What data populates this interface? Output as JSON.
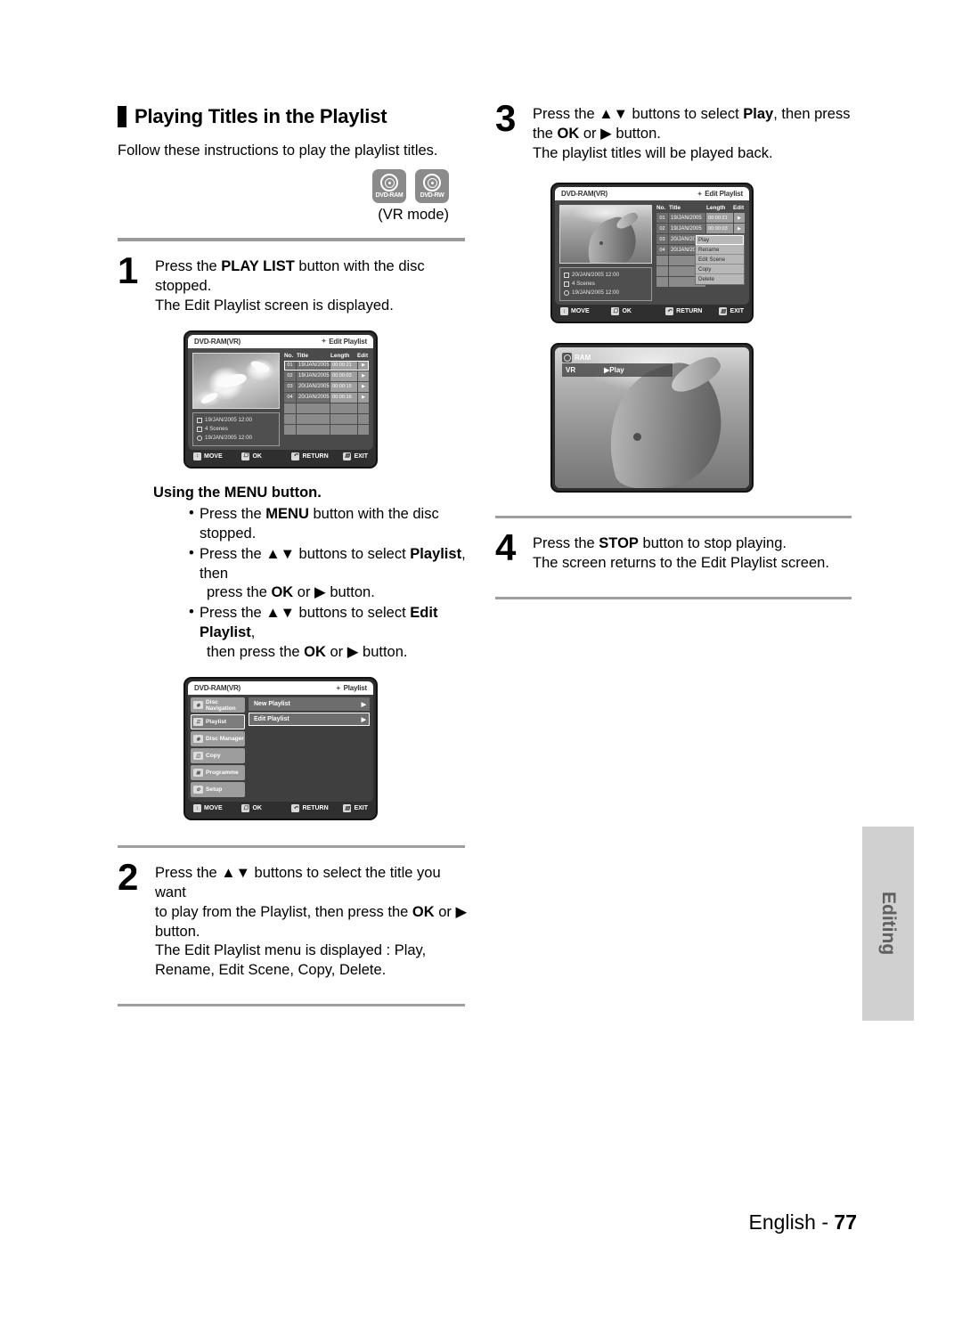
{
  "document": {
    "page_footer_label": "English -",
    "page_number": "77",
    "side_tab": "Editing"
  },
  "left_column": {
    "heading": "Playing Titles in the Playlist",
    "lead": "Follow these instructions to play the playlist titles.",
    "disc_logos": [
      {
        "label": "DVD-RAM",
        "icon": "disc-icon"
      },
      {
        "label": "DVD-RW",
        "icon": "disc-icon"
      }
    ],
    "mode_note": "(VR mode)",
    "step1": {
      "number": "1",
      "line1_a": "Press the ",
      "line1_b": "PLAY LIST",
      "line1_c": " button with the disc stopped.",
      "line2": "The Edit Playlist screen is displayed."
    },
    "menu_section": {
      "title": "Using the MENU button.",
      "bullets": [
        {
          "a": "Press the ",
          "b": "MENU",
          "c": " button with the disc stopped.",
          "cont": ""
        },
        {
          "a": "Press the ▲▼ buttons to select ",
          "b": "Playlist",
          "c": ", then",
          "cont": "press the OK or ▶ button."
        },
        {
          "a": "Press the ▲▼ buttons to select ",
          "b": "Edit Playlist",
          "c": ",",
          "cont": "then press the OK or ▶ button."
        }
      ]
    },
    "step2": {
      "number": "2",
      "line1": "Press the ▲▼ buttons to select the title you want",
      "line2_a": "to play from the Playlist, then press the ",
      "line2_b": "OK",
      "line2_c": " or  ▶",
      "line3": "button.",
      "line4": "The Edit Playlist menu is displayed : Play,",
      "line5": "Rename, Edit Scene, Copy, Delete."
    }
  },
  "right_column": {
    "step3": {
      "number": "3",
      "line1_a": "Press the ▲▼ buttons to select ",
      "line1_b": "Play",
      "line1_c": ", then press",
      "line2_a": "the ",
      "line2_b": "OK",
      "line2_c": " or  ▶ button.",
      "line3": "The playlist titles will be played back."
    },
    "step4": {
      "number": "4",
      "line1_a": "Press the ",
      "line1_b": "STOP",
      "line1_c": " button to stop playing.",
      "line2": "The screen returns to the Edit Playlist screen."
    }
  },
  "osd_panel_1": {
    "disc_label": "DVD-RAM(VR)",
    "screen_title": "Edit Playlist",
    "thumbnail": "seagulls-photo",
    "info": [
      {
        "icon": "calendar-icon",
        "text": "19/JAN/2005 12:00"
      },
      {
        "icon": "scenes-icon",
        "text": "4 Scenes"
      },
      {
        "icon": "clock-icon",
        "text": "19/JAN/2005 12:00"
      }
    ],
    "columns": [
      "No.",
      "Title",
      "Length",
      "Edit"
    ],
    "rows": [
      {
        "no": "01",
        "title": "19/JAN/2005",
        "length": "00:00:21",
        "edit": "▶",
        "selected": true
      },
      {
        "no": "02",
        "title": "19/JAN/2005",
        "length": "00:00:03",
        "edit": "▶",
        "selected": false
      },
      {
        "no": "03",
        "title": "20/JAN/2005",
        "length": "00:00:15",
        "edit": "▶",
        "selected": false
      },
      {
        "no": "04",
        "title": "20/JAN/2005",
        "length": "00:00:16",
        "edit": "▶",
        "selected": false
      }
    ],
    "footer": [
      {
        "icon": "updown-icon",
        "label": "MOVE"
      },
      {
        "icon": "ok-icon",
        "label": "OK"
      },
      {
        "icon": "return-icon",
        "label": "RETURN"
      },
      {
        "icon": "exit-icon",
        "label": "EXIT"
      }
    ]
  },
  "osd_panel_2": {
    "disc_label": "DVD-RAM(VR)",
    "screen_title": "Playlist",
    "menu_items": [
      {
        "label": "Disc Navigation",
        "icon": "disc-navigation-icon",
        "selected": false
      },
      {
        "label": "Playlist",
        "icon": "playlist-icon",
        "selected": true
      },
      {
        "label": "Disc Manager",
        "icon": "disc-manager-icon",
        "selected": false
      },
      {
        "label": "Copy",
        "icon": "copy-icon",
        "selected": false
      },
      {
        "label": "Programme",
        "icon": "programme-icon",
        "selected": false
      },
      {
        "label": "Setup",
        "icon": "setup-gear-icon",
        "selected": false
      }
    ],
    "submenu": [
      {
        "label": "New Playlist",
        "arrow": "▶",
        "selected": false
      },
      {
        "label": "Edit Playlist",
        "arrow": "▶",
        "selected": true
      }
    ],
    "footer": [
      {
        "icon": "updown-icon",
        "label": "MOVE"
      },
      {
        "icon": "ok-icon",
        "label": "OK"
      },
      {
        "icon": "return-icon",
        "label": "RETURN"
      },
      {
        "icon": "exit-icon",
        "label": "EXIT"
      }
    ]
  },
  "osd_panel_3": {
    "disc_label": "DVD-RAM(VR)",
    "screen_title": "Edit Playlist",
    "thumbnail": "dolphin-photo",
    "info": [
      {
        "icon": "calendar-icon",
        "text": "20/JAN/2005 12:00"
      },
      {
        "icon": "scenes-icon",
        "text": "4 Scenes"
      },
      {
        "icon": "clock-icon",
        "text": "19/JAN/2005 12:00"
      }
    ],
    "columns": [
      "No.",
      "Title",
      "Length",
      "Edit"
    ],
    "rows": [
      {
        "no": "01",
        "title": "19/JAN/2005",
        "length": "00:00:21",
        "edit": "▶"
      },
      {
        "no": "02",
        "title": "19/JAN/2005",
        "length": "00:00:03",
        "edit": "▶"
      },
      {
        "no": "03",
        "title": "20/JAN/2005",
        "length": "",
        "edit": ""
      },
      {
        "no": "04",
        "title": "20/JAN/2005",
        "length": "",
        "edit": ""
      }
    ],
    "popup": [
      {
        "label": "Play",
        "selected": true
      },
      {
        "label": "Rename",
        "selected": false
      },
      {
        "label": "Edit Scene",
        "selected": false
      },
      {
        "label": "Copy",
        "selected": false
      },
      {
        "label": "Delete",
        "selected": false
      }
    ],
    "footer": [
      {
        "icon": "updown-icon",
        "label": "MOVE"
      },
      {
        "icon": "ok-icon",
        "label": "OK"
      },
      {
        "icon": "return-icon",
        "label": "RETURN"
      },
      {
        "icon": "exit-icon",
        "label": "EXIT"
      }
    ]
  },
  "video_panel": {
    "thumbnail": "dolphin-photo-large",
    "badge_disc": "RAM",
    "badge_mode": "VR",
    "badge_state": "▶Play"
  }
}
